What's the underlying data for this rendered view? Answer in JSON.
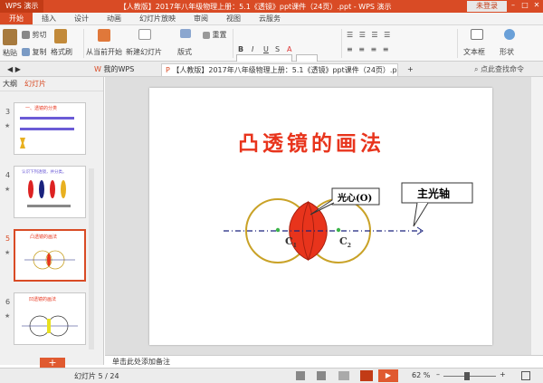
{
  "app": {
    "logo": "WPS 演示",
    "window_title": "【人教版】2017年八年级物理上册：5.1《透镜》ppt课件（24页）.ppt - WPS 演示",
    "login": "未登录"
  },
  "menu": [
    "开始",
    "插入",
    "设计",
    "动画",
    "幻灯片放映",
    "审阅",
    "视图",
    "云服务"
  ],
  "ribbon": {
    "paste": "粘贴",
    "cut": "剪切",
    "copy": "复制",
    "format_painter": "格式刷",
    "from_current": "从当前开始",
    "new_slide": "新建幻灯片",
    "layout": "版式",
    "reset": "重置",
    "textbox": "文本框",
    "shapes": "形状"
  },
  "tabs": {
    "home": "我的WPS",
    "doc": "【人教版】2017年八年级物理上册：5.1《透镜》ppt课件（24页）.ppt",
    "search": "点此查找命令"
  },
  "panel": {
    "outline": "大纲",
    "slides": "幻灯片"
  },
  "thumbnails": [
    {
      "num": "3",
      "title": "一、透镜的分类"
    },
    {
      "num": "4",
      "title": "认识下列透镜，并分类。"
    },
    {
      "num": "5",
      "title": "凸透镜的画法"
    },
    {
      "num": "6",
      "title": "凹透镜的画法"
    }
  ],
  "slide": {
    "title": "凸透镜的画法",
    "callout_center": "光心(O)",
    "callout_axis": "主光轴",
    "c1": "C",
    "c1_sub": "1",
    "c2": "C",
    "c2_sub": "2"
  },
  "notes_placeholder": "单击此处添加备注",
  "status": {
    "slide_counter": "幻灯片 5 / 24",
    "zoom": "62 %"
  },
  "colors": {
    "accent": "#d94b25",
    "title_red": "#e8341c",
    "circle": "#c9a227",
    "lens": "#e8341c",
    "axis": "#1a237e",
    "dot": "#3db54a"
  }
}
